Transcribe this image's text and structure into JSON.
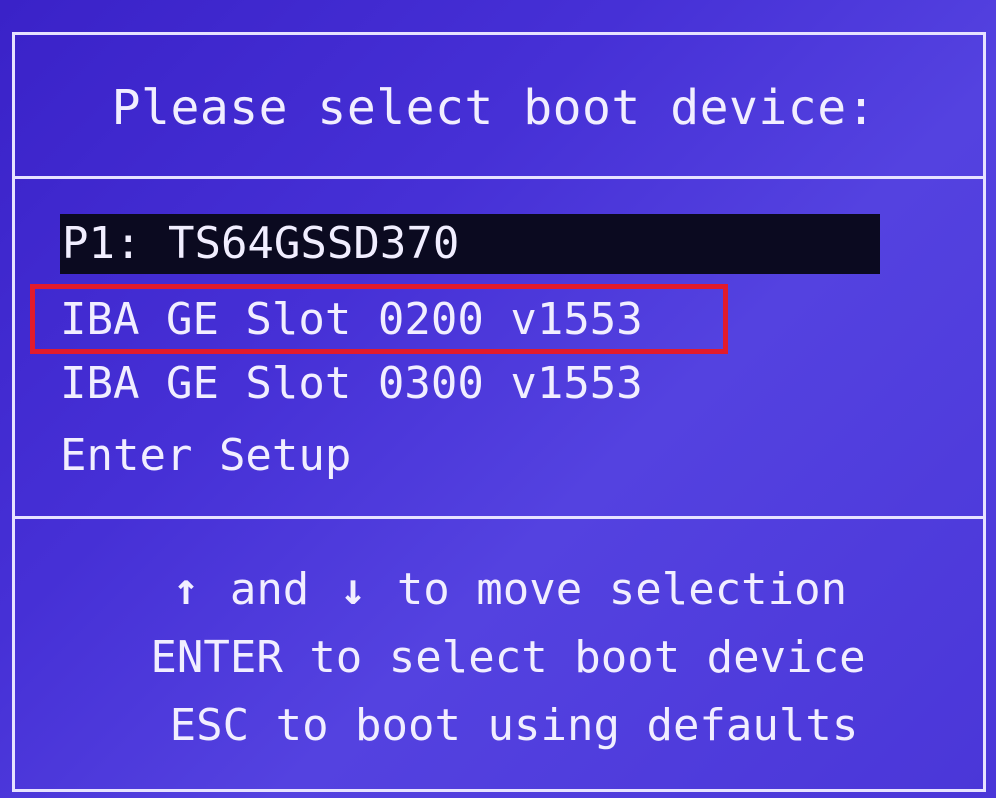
{
  "title": "Please select boot device:",
  "boot_devices": [
    {
      "label": "P1: TS64GSSD370",
      "selected": true
    },
    {
      "label": "IBA GE Slot 0200 v1553",
      "selected": false
    },
    {
      "label": "IBA GE Slot 0300 v1553",
      "selected": false
    },
    {
      "label": "Enter Setup",
      "selected": false
    }
  ],
  "help": {
    "move_text": "and",
    "move_suffix": "to move selection",
    "enter_text": "ENTER to select boot device",
    "esc_text": "ESC to boot using defaults"
  },
  "icons": {
    "up": "up-arrow-icon",
    "down": "down-arrow-icon"
  },
  "colors": {
    "background": "#4630d6",
    "text": "#f1eeff",
    "selected_bg": "#0b0a20",
    "annotation": "#e21b2c"
  }
}
